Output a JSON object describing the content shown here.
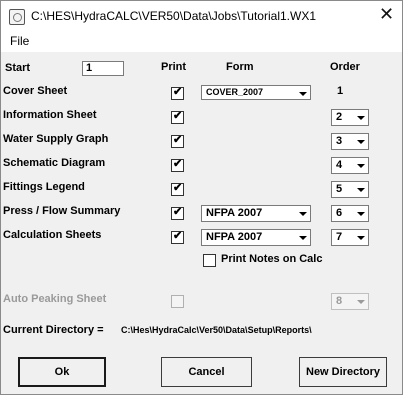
{
  "window": {
    "title": "C:\\HES\\HydraCALC\\VER50\\Data\\Jobs\\Tutorial1.WX1",
    "close_glyph": "✕",
    "icon": "app-icon"
  },
  "menu": {
    "file": "File"
  },
  "headers": {
    "start": "Start",
    "print": "Print",
    "form": "Form",
    "order": "Order"
  },
  "start_value": "1",
  "rows": [
    {
      "label": "Cover Sheet",
      "print": true,
      "form": "COVER_2007",
      "order": "1"
    },
    {
      "label": "Information Sheet",
      "print": true,
      "form": "",
      "order": "2"
    },
    {
      "label": "Water Supply Graph",
      "print": true,
      "form": "",
      "order": "3"
    },
    {
      "label": "Schematic Diagram",
      "print": true,
      "form": "",
      "order": "4"
    },
    {
      "label": "Fittings Legend",
      "print": true,
      "form": "",
      "order": "5"
    },
    {
      "label": "Press / Flow Summary",
      "print": true,
      "form": "NFPA 2007",
      "order": "6"
    },
    {
      "label": "Calculation Sheets",
      "print": true,
      "form": "NFPA 2007",
      "order": "7"
    }
  ],
  "print_notes": {
    "label": "Print Notes on Calc",
    "checked": false
  },
  "auto_peaking": {
    "label": "Auto Peaking Sheet",
    "order": "8",
    "enabled": false
  },
  "current_directory": {
    "label": "Current Directory =",
    "path": "C:\\Hes\\HydraCalc\\Ver50\\Data\\Setup\\Reports\\"
  },
  "buttons": {
    "ok": "Ok",
    "cancel": "Cancel",
    "new_directory": "New Directory"
  },
  "check_glyph": "✔"
}
